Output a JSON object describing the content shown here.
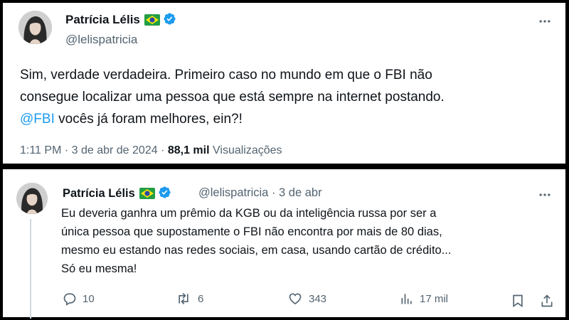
{
  "tweet1": {
    "author_name": "Patrícia Lélis",
    "handle": "@lelispatricia",
    "text_line1": "Sim, verdade verdadeira. Primeiro caso no mundo em que o FBI não",
    "text_line2": "consegue localizar uma pessoa que está sempre na internet postando.",
    "mention": "@FBI",
    "text_line3_rest": " vocês já foram melhores, ein?!",
    "time": "1:11 PM · 3 de abr de 2024 ·",
    "views_count": "88,1 mil",
    "views_label": "Visualizações"
  },
  "tweet2": {
    "author_name": "Patrícia Lélis",
    "handle": "@lelispatricia · 3 de abr",
    "text_line1": "Eu deveria ganhra um prêmio da KGB ou da inteligência russa por ser a",
    "text_line2": "única pessoa que supostamente o FBI não encontra por mais de 80 dias,",
    "text_line3": "mesmo eu estando nas redes sociais, em casa, usando cartão de crédito...",
    "text_line4": "Só eu mesma!",
    "replies": "10",
    "retweets": "6",
    "likes": "343",
    "views": "17 mil"
  },
  "icons": [
    "more-icon",
    "verified-badge-icon",
    "brazil-flag-icon",
    "reply-icon",
    "retweet-icon",
    "like-icon",
    "views-icon",
    "bookmark-icon",
    "share-icon"
  ],
  "colors": {
    "verified": "#1d9bf0",
    "mention": "#1d9bf0",
    "secondary_text": "#536471",
    "primary_text": "#0f1419"
  }
}
